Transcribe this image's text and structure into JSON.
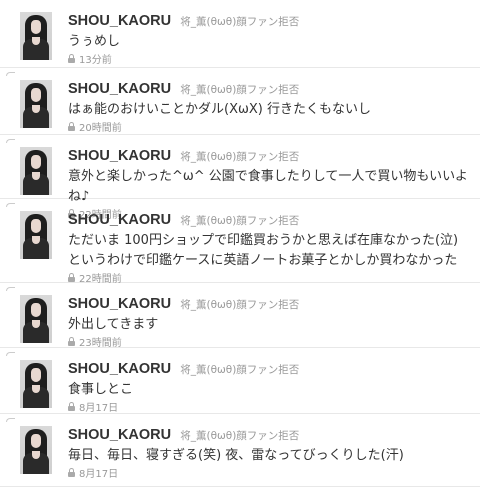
{
  "tweets": [
    {
      "screen_name": "SHOU_KAORU",
      "full_name": "将_薫(θωθ)顔ファン拒否",
      "text": "うぅめし",
      "time": "13分前"
    },
    {
      "screen_name": "SHOU_KAORU",
      "full_name": "将_薫(θωθ)顔ファン拒否",
      "text": "はぁ能のおけいことかダル(XωX) 行きたくもないし",
      "time": "20時間前"
    },
    {
      "screen_name": "SHOU_KAORU",
      "full_name": "将_薫(θωθ)顔ファン拒否",
      "text": "意外と楽しかった^ω^ 公園で食事したりして一人で買い物もいいよね♪",
      "time": "22時間前"
    },
    {
      "screen_name": "SHOU_KAORU",
      "full_name": "将_薫(θωθ)顔ファン拒否",
      "text": "ただいま 100円ショップで印鑑買おうかと思えば在庫なかった(泣) というわけで印鑑ケースに英語ノートお菓子とかしか買わなかった",
      "time": "22時間前"
    },
    {
      "screen_name": "SHOU_KAORU",
      "full_name": "将_薫(θωθ)顔ファン拒否",
      "text": "外出してきます",
      "time": "23時間前"
    },
    {
      "screen_name": "SHOU_KAORU",
      "full_name": "将_薫(θωθ)顔ファン拒否",
      "text": "食事しとこ",
      "time": "8月17日"
    },
    {
      "screen_name": "SHOU_KAORU",
      "full_name": "将_薫(θωθ)顔ファン拒否",
      "text": "毎日、毎日、寝すぎる(笑) 夜、雷なってびっくりした(汗)",
      "time": "8月17日"
    }
  ]
}
